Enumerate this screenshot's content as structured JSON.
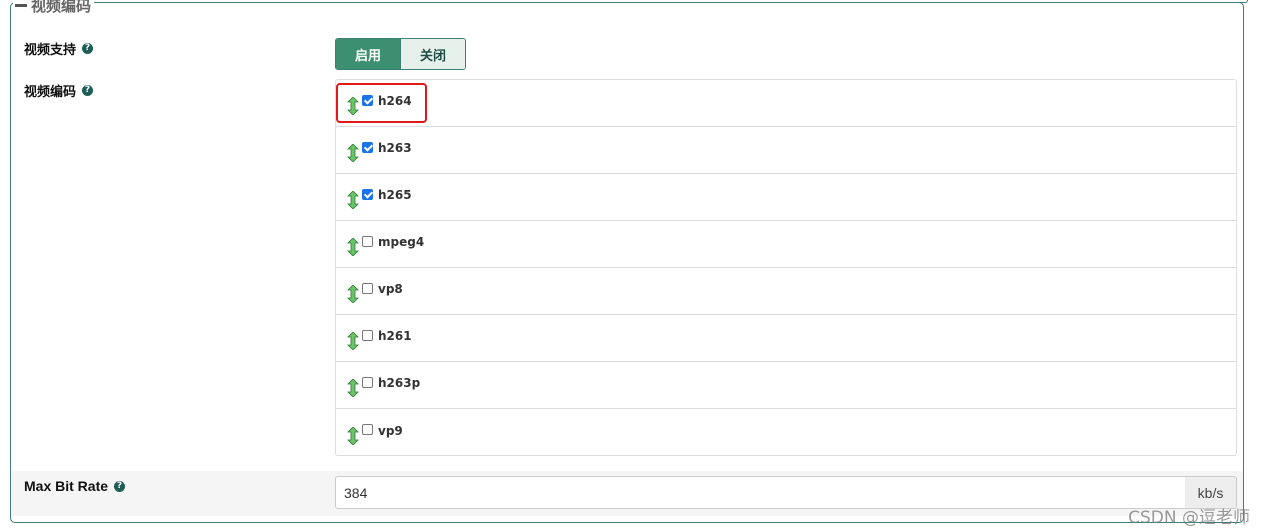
{
  "section": {
    "title": "视频编码"
  },
  "video_support": {
    "label": "视频支持",
    "enable_label": "启用",
    "disable_label": "关闭",
    "selected": "启用"
  },
  "video_codecs": {
    "label": "视频编码",
    "items": [
      {
        "name": "h264",
        "checked": true
      },
      {
        "name": "h263",
        "checked": true
      },
      {
        "name": "h265",
        "checked": true
      },
      {
        "name": "mpeg4",
        "checked": false
      },
      {
        "name": "vp8",
        "checked": false
      },
      {
        "name": "h261",
        "checked": false
      },
      {
        "name": "h263p",
        "checked": false
      },
      {
        "name": "vp9",
        "checked": false
      }
    ]
  },
  "max_bit_rate": {
    "label": "Max Bit Rate",
    "value": "384",
    "unit": "kb/s"
  },
  "watermark": "CSDN @逗老师",
  "colors": {
    "accent": "#3d8f72",
    "border": "#3d7f76",
    "highlight": "#e0191b",
    "checkbox": "#1a73e8"
  }
}
